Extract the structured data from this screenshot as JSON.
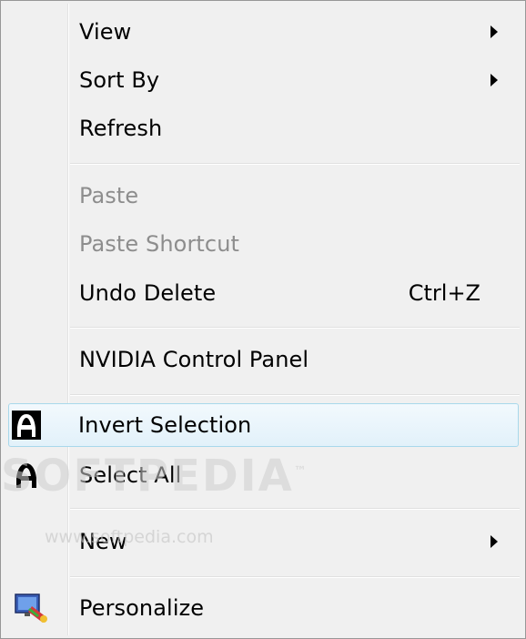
{
  "menu": {
    "items": [
      {
        "label": "View"
      },
      {
        "label": "Sort By"
      },
      {
        "label": "Refresh"
      },
      {
        "label": "Paste"
      },
      {
        "label": "Paste Shortcut"
      },
      {
        "label": "Undo Delete",
        "shortcut": "Ctrl+Z"
      },
      {
        "label": "NVIDIA Control Panel"
      },
      {
        "label": "Invert Selection"
      },
      {
        "label": "Select All"
      },
      {
        "label": "New"
      },
      {
        "label": "Personalize"
      }
    ]
  },
  "icons": {
    "invert_selection": "invert-selection-icon",
    "select_all": "select-all-icon",
    "personalize": "personalize-icon",
    "submenu": "submenu-arrow-icon"
  },
  "watermark": {
    "text": "SOFTPEDIA",
    "tm": "™",
    "url": "www.softpedia.com"
  },
  "colors": {
    "menu_bg": "#f0f0f0",
    "hover_border": "#a8d8eb",
    "disabled_text": "#8d8d8d"
  }
}
